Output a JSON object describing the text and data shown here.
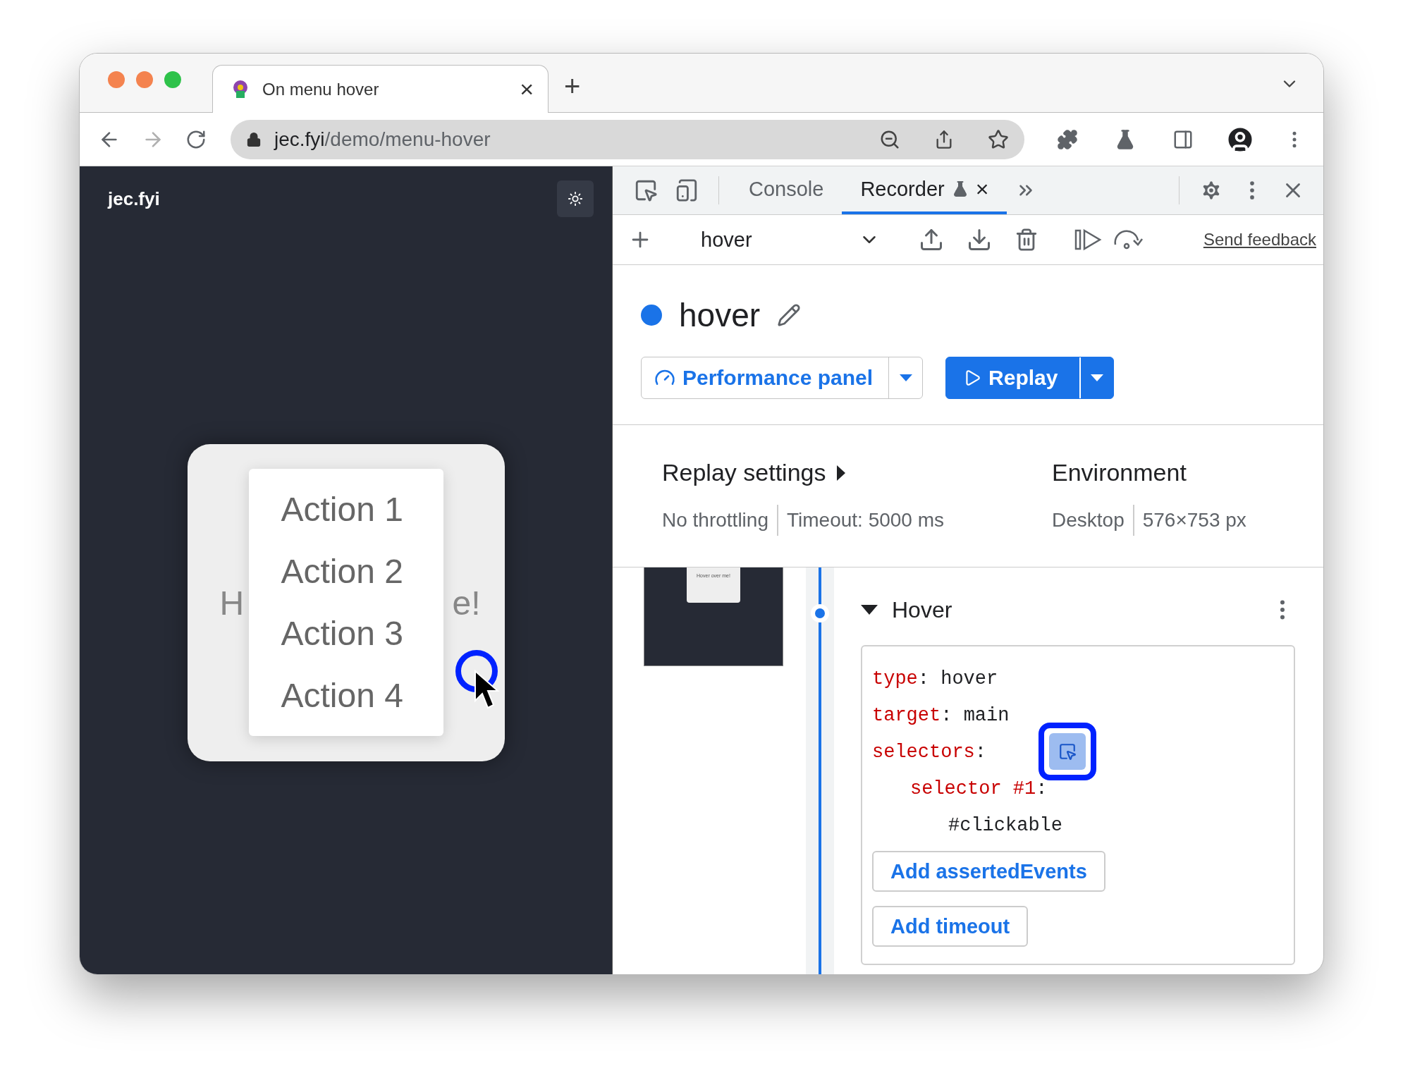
{
  "browser": {
    "tab": {
      "title": "On menu hover",
      "close": "×"
    },
    "new_tab": "+",
    "url": {
      "host": "jec.fyi",
      "path": "/demo/menu-hover"
    }
  },
  "page": {
    "brand": "jec.fyi",
    "card_text_left": "H",
    "card_text_right": "e!",
    "menu": [
      "Action 1",
      "Action 2",
      "Action 3",
      "Action 4"
    ]
  },
  "devtools": {
    "tabs": [
      {
        "label": "Console",
        "selected": false,
        "closable": false
      },
      {
        "label": "Recorder",
        "selected": true,
        "closable": true
      }
    ],
    "tab_close": "×",
    "recording_select": "hover",
    "send_feedback": "Send feedback",
    "recording": {
      "title": "hover",
      "performance_button": "Performance panel",
      "replay_button": "Replay"
    },
    "replay_settings": {
      "title": "Replay settings",
      "items": [
        "No throttling",
        "Timeout: 5000 ms"
      ]
    },
    "environment": {
      "title": "Environment",
      "items": [
        "Desktop",
        "576×753 px"
      ]
    },
    "step": {
      "thumbnail_text": "Hover over me!",
      "title": "Hover",
      "expanded": true,
      "separator": ":",
      "fields": [
        {
          "key": "type",
          "value": "hover"
        },
        {
          "key": "target",
          "value": "main"
        },
        {
          "key": "selectors",
          "picker": true,
          "children": [
            {
              "key": "selector #1",
              "children": [
                {
                  "value": "#clickable"
                }
              ]
            }
          ]
        }
      ],
      "buttons": [
        "Add assertedEvents",
        "Add timeout"
      ]
    }
  }
}
